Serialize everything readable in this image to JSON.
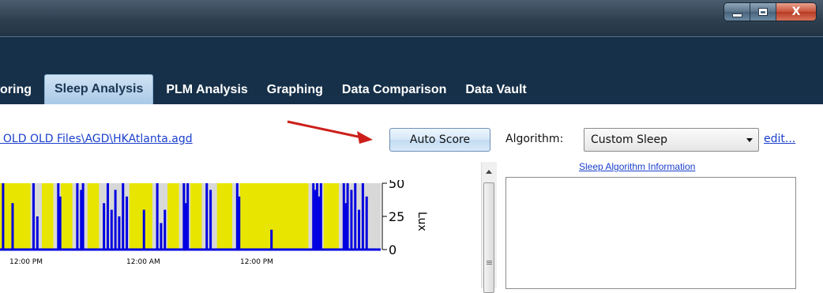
{
  "window": {
    "controls": {
      "minimize_icon": "minimize-icon",
      "maximize_icon": "maximize-icon",
      "close_label": "X"
    }
  },
  "tabs": [
    {
      "label": "oring",
      "active": false
    },
    {
      "label": "Sleep Analysis",
      "active": true
    },
    {
      "label": "PLM Analysis",
      "active": false
    },
    {
      "label": "Graphing",
      "active": false
    },
    {
      "label": "Data Comparison",
      "active": false
    },
    {
      "label": "Data Vault",
      "active": false
    }
  ],
  "file": {
    "path": ") OLD OLD Files\\AGD\\HKAtlanta.agd"
  },
  "annotation": {
    "arrow_color": "#cc1f1a"
  },
  "toolbar": {
    "auto_score_label": "Auto Score"
  },
  "algorithm": {
    "label": "Algorithm:",
    "selected": "Custom Sleep",
    "edit_label": "edit...",
    "info_link": "Sleep Algorithm Information"
  },
  "chart": {
    "y_axis_label": "Lux",
    "y_ticks": [
      "50",
      "25",
      "0"
    ],
    "x_ticks": [
      "12:00 PM",
      "12:00 AM",
      "12:00 PM"
    ]
  },
  "chart_data": {
    "type": "area",
    "ylabel": "Lux",
    "ylim": [
      0,
      50
    ],
    "x_ticks": [
      "12:00 PM",
      "12:00 AM",
      "12:00 PM"
    ],
    "colors": {
      "sleep_region": "#e8e600",
      "activity": "#0000e0",
      "background": "#d8d8d8"
    },
    "sleep_regions": [
      [
        0.0,
        0.08
      ],
      [
        0.11,
        0.14
      ],
      [
        0.16,
        0.19
      ],
      [
        0.23,
        0.26
      ],
      [
        0.34,
        0.4
      ],
      [
        0.44,
        0.47
      ],
      [
        0.5,
        0.53
      ],
      [
        0.57,
        0.61
      ],
      [
        0.63,
        0.81
      ],
      [
        0.85,
        0.89
      ]
    ],
    "activity_bars": [
      [
        0.005,
        1.0
      ],
      [
        0.03,
        0.7
      ],
      [
        0.085,
        1.0
      ],
      [
        0.095,
        0.5
      ],
      [
        0.15,
        1.0
      ],
      [
        0.155,
        0.8
      ],
      [
        0.2,
        1.0
      ],
      [
        0.21,
        0.9
      ],
      [
        0.215,
        1.0
      ],
      [
        0.27,
        0.7
      ],
      [
        0.28,
        1.0
      ],
      [
        0.29,
        0.6
      ],
      [
        0.3,
        0.9
      ],
      [
        0.31,
        0.5
      ],
      [
        0.32,
        1.0
      ],
      [
        0.33,
        0.8
      ],
      [
        0.375,
        0.6
      ],
      [
        0.41,
        1.0
      ],
      [
        0.42,
        0.4
      ],
      [
        0.43,
        0.6
      ],
      [
        0.48,
        1.0
      ],
      [
        0.485,
        0.7
      ],
      [
        0.49,
        1.0
      ],
      [
        0.54,
        1.0
      ],
      [
        0.55,
        0.9
      ],
      [
        0.62,
        1.0
      ],
      [
        0.625,
        0.8
      ],
      [
        0.71,
        0.3
      ],
      [
        0.82,
        1.0
      ],
      [
        0.825,
        0.9
      ],
      [
        0.83,
        1.0
      ],
      [
        0.835,
        0.8
      ],
      [
        0.84,
        1.0
      ],
      [
        0.9,
        1.0
      ],
      [
        0.905,
        0.7
      ],
      [
        0.91,
        1.0
      ],
      [
        0.92,
        0.9
      ],
      [
        0.93,
        1.0
      ],
      [
        0.94,
        0.6
      ],
      [
        0.95,
        1.0
      ],
      [
        0.96,
        0.8
      ]
    ],
    "grid": false
  }
}
